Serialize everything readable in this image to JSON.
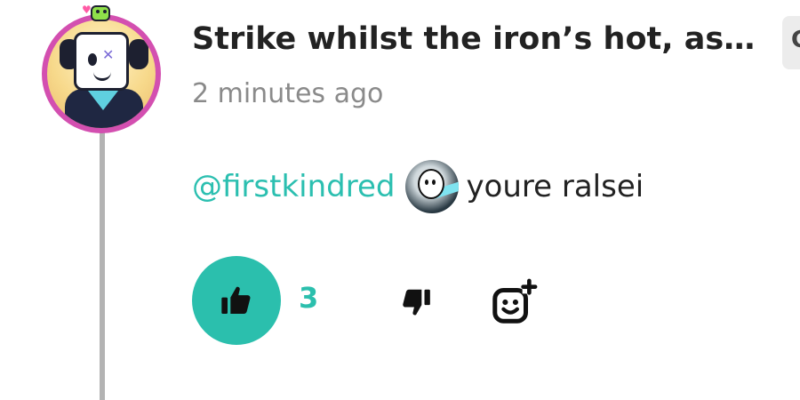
{
  "comment": {
    "title": "Strike whilst the iron’s hot, as a comment on Amino",
    "timestamp": "2 minutes ago",
    "mention": "@firstkindred",
    "text": "youre ralsei",
    "like_count": "3",
    "side_tab_label": "C"
  },
  "icons": {
    "like": "thumbs-up-icon",
    "dislike": "thumbs-down-icon",
    "react": "add-reaction-icon"
  },
  "colors": {
    "accent": "#2bbfad",
    "avatar_ring": "#d34fb0",
    "thread_line": "#b3b3b3"
  }
}
